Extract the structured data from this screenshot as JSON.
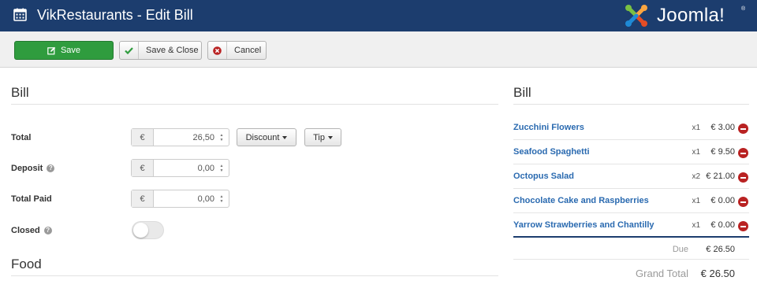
{
  "header": {
    "title": "VikRestaurants - Edit Bill",
    "calendar_icon": "calendar-icon",
    "logo_text": "Joomla!",
    "logo_reg": "®",
    "colors": {
      "bar": "#1c3d6e",
      "logo_red": "#e44d26",
      "logo_green": "#7ac143",
      "logo_orange": "#f9a541",
      "logo_blue": "#1e8ad6"
    }
  },
  "toolbar": {
    "save_label": "Save",
    "save_close_label": "Save & Close",
    "cancel_label": "Cancel",
    "colors": {
      "save": "#2f9c3e"
    }
  },
  "form": {
    "bill_heading": "Bill",
    "total_label": "Total",
    "total_currency": "€",
    "total_value": "26,50",
    "discount_label": "Discount",
    "tip_label": "Tip",
    "deposit_label": "Deposit",
    "deposit_currency": "€",
    "deposit_value": "0,00",
    "total_paid_label": "Total Paid",
    "total_paid_currency": "€",
    "total_paid_value": "0,00",
    "closed_label": "Closed",
    "closed_value": false,
    "help_glyph": "?",
    "food_heading": "Food"
  },
  "bill": {
    "heading": "Bill",
    "items": [
      {
        "name": "Zucchini Flowers",
        "qty": "x1",
        "price": "€ 3.00"
      },
      {
        "name": "Seafood Spaghetti",
        "qty": "x1",
        "price": "€ 9.50"
      },
      {
        "name": "Octopus Salad",
        "qty": "x2",
        "price": "€ 21.00"
      },
      {
        "name": "Chocolate Cake and Raspberries",
        "qty": "x1",
        "price": "€ 0.00"
      },
      {
        "name": "Yarrow Strawberries and Chantilly",
        "qty": "x1",
        "price": "€ 0.00"
      }
    ],
    "due_label": "Due",
    "due_value": "€ 26.50",
    "grand_total_label": "Grand Total",
    "grand_total_value": "€ 26.50",
    "colors": {
      "item_link": "#2a6ab0",
      "remove": "#b92222",
      "divider": "#1c3d6e"
    }
  }
}
